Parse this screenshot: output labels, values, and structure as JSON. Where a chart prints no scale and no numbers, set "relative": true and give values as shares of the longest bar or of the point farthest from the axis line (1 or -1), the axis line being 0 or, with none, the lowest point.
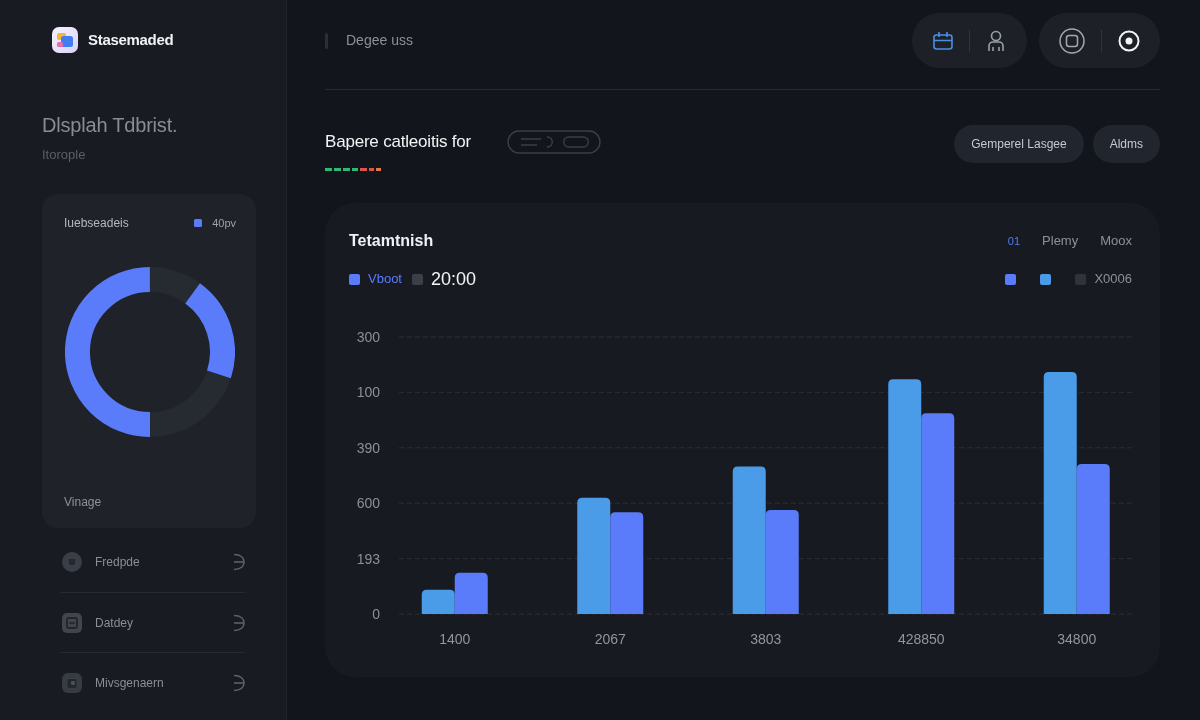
{
  "sidebar": {
    "brand": "Stasemaded",
    "heading": "Dlsplah Tdbrist.",
    "subheading": "Itorople",
    "donut_card": {
      "title": "Iuebseadeis",
      "legend": {
        "label": "40pv",
        "color": "#5b7cfa"
      },
      "caption": "Vinage"
    },
    "items": [
      {
        "label": "Fredpde"
      },
      {
        "label": "Datdey"
      },
      {
        "label": "Mivsgenaern"
      }
    ]
  },
  "topbar": {
    "breadcrumb": "Degee uss"
  },
  "header": {
    "title": "Bapere catleoitis for",
    "buttons": [
      "Gemperel Lasgee",
      "Aldms"
    ]
  },
  "chart_card": {
    "title": "Tetamtnish",
    "tabs": [
      {
        "label": "01",
        "selected": true
      },
      {
        "label": "Plemy",
        "selected": false
      },
      {
        "label": "Moox",
        "selected": false
      }
    ],
    "legend_left": [
      {
        "kind": "accent",
        "label": "Vboot",
        "color": "#5b7cfa"
      },
      {
        "kind": "figure",
        "label": "20:00",
        "color": "#3a3f48"
      }
    ],
    "legend_right": [
      {
        "kind": "swatch",
        "color": "#5b7cfa"
      },
      {
        "kind": "swatch",
        "color": "#4a9be8"
      },
      {
        "kind": "muted",
        "label": "X0006",
        "color": "#2f333b"
      }
    ],
    "y_axis_labels": [
      "300",
      "100",
      "390",
      "600",
      "193",
      "0"
    ],
    "chart_data": {
      "type": "bar",
      "relative": true,
      "categories": [
        "1400",
        "2067",
        "3803",
        "428850",
        "34800"
      ],
      "series": [
        {
          "color": "#4a9be8",
          "values": [
            0.1,
            0.48,
            0.61,
            0.97,
            1
          ]
        },
        {
          "color": "#5b7cfa",
          "values": [
            0.17,
            0.42,
            0.43,
            0.83,
            0.62
          ]
        }
      ]
    }
  }
}
